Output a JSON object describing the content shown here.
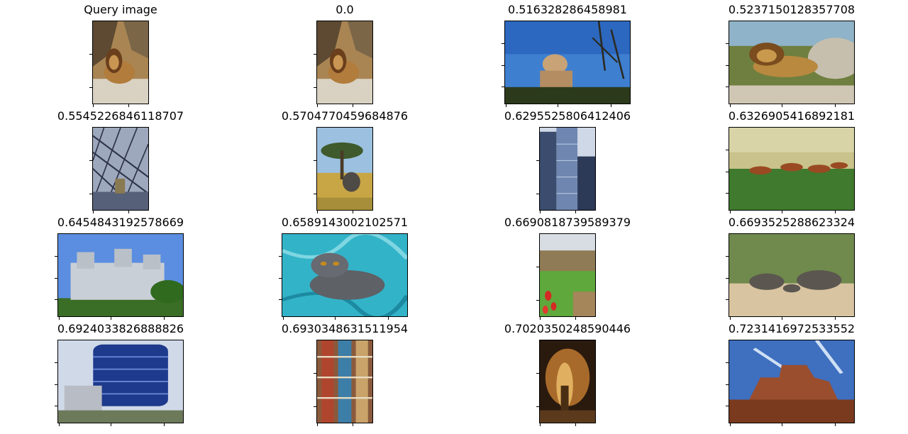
{
  "figure": {
    "panels": [
      {
        "title": "Query image",
        "icon": "lion-photo-icon",
        "scene": "lion",
        "aspect": "portrait"
      },
      {
        "title": "0.0",
        "icon": "lion-photo-icon",
        "scene": "lion",
        "aspect": "portrait"
      },
      {
        "title": "0.516328286458981",
        "icon": "cougar-photo-icon",
        "scene": "cougar",
        "aspect": "landscape"
      },
      {
        "title": "0.5237150128357708",
        "icon": "lion-rocks-photo-icon",
        "scene": "lion2",
        "aspect": "landscape"
      },
      {
        "title": "0.5545226846118707",
        "icon": "glass-dome-photo-icon",
        "scene": "dome",
        "aspect": "portrait"
      },
      {
        "title": "0.5704770459684876",
        "icon": "elephant-photo-icon",
        "scene": "elephant",
        "aspect": "portrait"
      },
      {
        "title": "0.6295525806412406",
        "icon": "skyscrapers-photo-icon",
        "scene": "skyscraper",
        "aspect": "portrait"
      },
      {
        "title": "0.6326905416892181",
        "icon": "antelopes-photo-icon",
        "scene": "antelope",
        "aspect": "landscape"
      },
      {
        "title": "0.6454843192578669",
        "icon": "castle-photo-icon",
        "scene": "castle",
        "aspect": "landscape"
      },
      {
        "title": "0.6589143002102571",
        "icon": "grey-cat-photo-icon",
        "scene": "cat",
        "aspect": "landscape"
      },
      {
        "title": "0.6690818739589379",
        "icon": "garden-photo-icon",
        "scene": "garden",
        "aspect": "portrait"
      },
      {
        "title": "0.6693525288623324",
        "icon": "elephant-herd-photo-icon",
        "scene": "elephants",
        "aspect": "landscape"
      },
      {
        "title": "0.6924033826888826",
        "icon": "glass-building-photo-icon",
        "scene": "building",
        "aspect": "landscape"
      },
      {
        "title": "0.6930348631511954",
        "icon": "tapestry-photo-icon",
        "scene": "tapestry",
        "aspect": "portrait"
      },
      {
        "title": "0.7020350248590446",
        "icon": "cave-photo-icon",
        "scene": "cave",
        "aspect": "portrait"
      },
      {
        "title": "0.7231416972533552",
        "icon": "mesa-photo-icon",
        "scene": "mesa",
        "aspect": "landscape"
      }
    ]
  }
}
